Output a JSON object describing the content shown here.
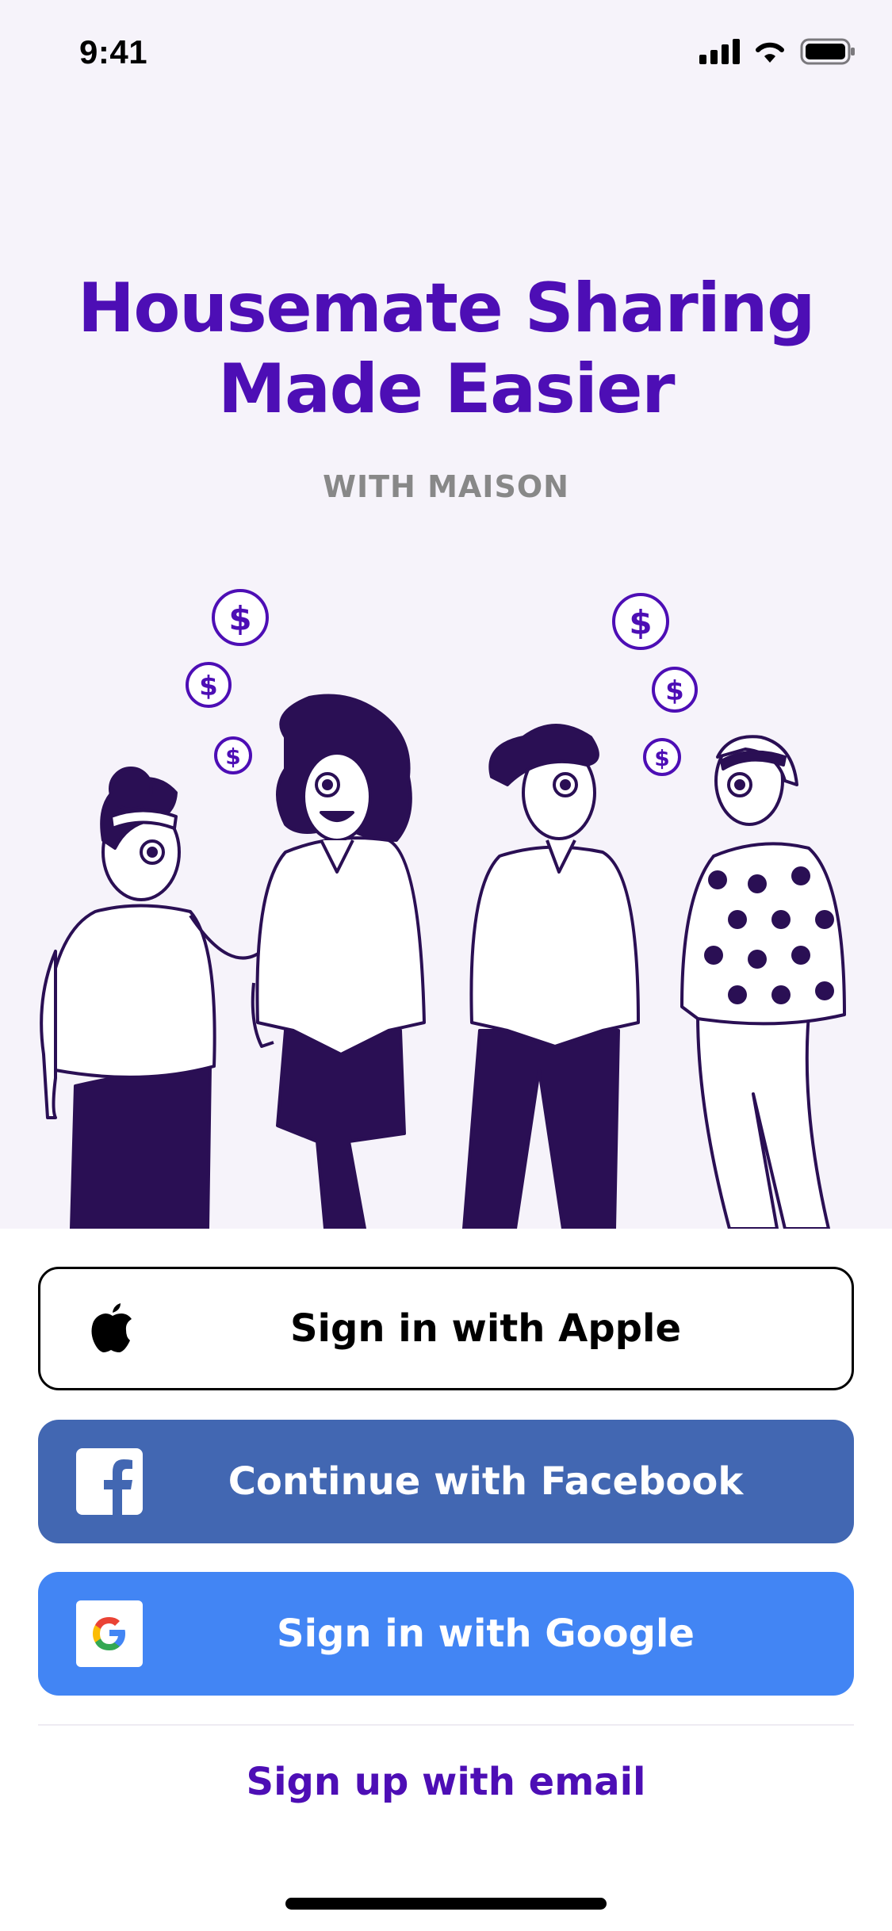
{
  "status_bar": {
    "time": "9:41"
  },
  "hero": {
    "title_line1": "Housemate Sharing",
    "title_line2": "Made Easier",
    "subtitle": "WITH MAISON",
    "background": "#F6F3FA",
    "accent": "#4D0EB5"
  },
  "illustration": {
    "coin_symbol": "$",
    "figure_colors": {
      "outline": "#2A0F54",
      "coin": "#4D0EB5"
    }
  },
  "auth": {
    "apple_label": "Sign in with Apple",
    "facebook_label": "Continue with Facebook",
    "google_label": "Sign in with Google",
    "email_label": "Sign up with email",
    "facebook_color": "#4267B2",
    "google_color": "#4285F4"
  },
  "icons": {
    "apple": "apple-logo-icon",
    "facebook": "facebook-logo-icon",
    "google": "google-logo-icon",
    "signal": "cellular-signal-icon",
    "wifi": "wifi-icon",
    "battery": "battery-icon"
  }
}
